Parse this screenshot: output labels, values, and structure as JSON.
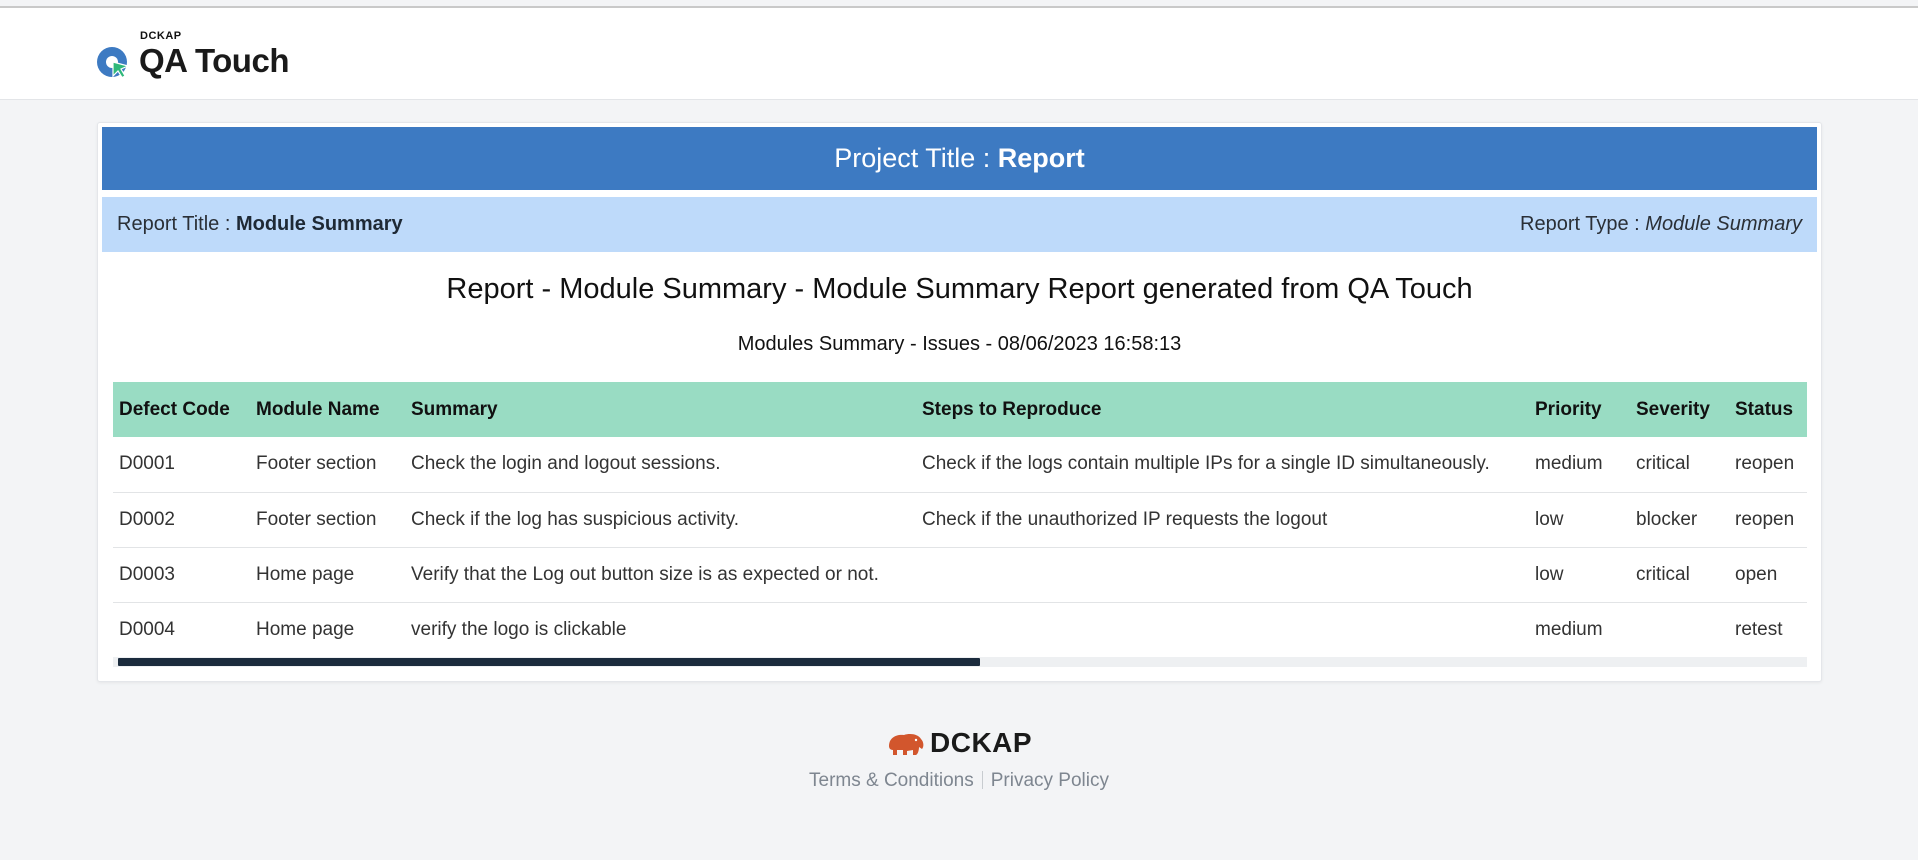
{
  "header": {
    "brand_small": "DCKAP",
    "brand_name": "QA Touch"
  },
  "project": {
    "label": "Project Title : ",
    "value": "Report"
  },
  "report": {
    "title_label": "Report Title : ",
    "title_value": "Module Summary",
    "type_label": "Report Type : ",
    "type_value": "Module Summary"
  },
  "heading": "Report - Module Summary - Module Summary Report generated from QA Touch",
  "subheading": "Modules Summary - Issues - 08/06/2023 16:58:13",
  "table": {
    "columns": [
      "Defect Code",
      "Module Name",
      "Summary",
      "Steps to Reproduce",
      "Priority",
      "Severity",
      "Status"
    ],
    "rows": [
      [
        "D0001",
        "Footer section",
        "Check the login and logout sessions.",
        "Check if the logs contain multiple IPs for a single ID simultaneously.",
        "medium",
        "critical",
        "reopen"
      ],
      [
        "D0002",
        "Footer section",
        "Check if the log has suspicious activity.",
        "Check if the unauthorized IP requests the logout",
        "low",
        "blocker",
        "reopen"
      ],
      [
        "D0003",
        "Home page",
        "Verify that the Log out button size is as expected or not.",
        "",
        "low",
        "critical",
        "open"
      ],
      [
        "D0004",
        "Home page",
        "verify the logo is clickable",
        "",
        "medium",
        "",
        "retest"
      ]
    ]
  },
  "footer": {
    "logo_text": "DCKAP",
    "terms": "Terms & Conditions",
    "privacy": "Privacy Policy"
  },
  "colors": {
    "project_bar": "#3d7ac2",
    "report_bar": "#bedafa",
    "table_header": "#99dcc3",
    "scrollbar_thumb": "#1b2b3d"
  }
}
